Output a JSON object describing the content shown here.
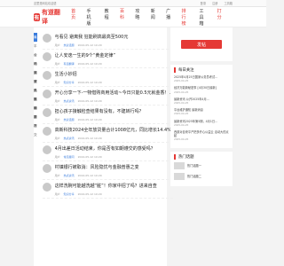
{
  "topbar": {
    "left": "这里是网站欢迎语",
    "links": [
      "登录",
      "注册",
      "工具箱"
    ]
  },
  "brand": {
    "mark": "有",
    "name": "有道翻译"
  },
  "nav": [
    "首页",
    "手机版",
    "教程",
    "百科",
    "攻略",
    "新闻",
    "广播",
    "排行榜",
    "工具箱",
    "打分"
  ],
  "sidebar": [
    "最高分享",
    "平台动态",
    "公司交流",
    "热点资讯",
    "知识分享",
    "常见疑问",
    "热议话题",
    "热榜推荐",
    "我要提交"
  ],
  "feed": [
    {
      "title": "与看见 避离我 狂能刷高最高至500元",
      "author": "用户",
      "tag": "热议话题",
      "date": "2024-05-12 10:29"
    },
    {
      "title": "让人安逸一生的9个“黄金定律”",
      "author": "用户",
      "tag": "有道翻译",
      "date": "2024-05-12 10:29"
    },
    {
      "title": "生活小妙招",
      "author": "用户",
      "tag": "知识分享",
      "date": "2024-05-12 10:29"
    },
    {
      "title": "开心分享一下-一物借购商用活动~今日只能0.5元就金香！...",
      "author": "用户",
      "tag": "热点资讯",
      "date": "2024-05-12 10:29"
    },
    {
      "title": "担心孩子接触检查结果有没有，不建转行吗？",
      "author": "用户",
      "tag": "热议话题",
      "date": "2024-05-12 10:29"
    },
    {
      "title": "高新科技2024全年放贷量合计1008亿元，同比增长14.4%",
      "author": "用户",
      "tag": "热点资讯",
      "date": "2024-05-12 10:29"
    },
    {
      "title": "4月出差日活动结束，你是否有如期遵交的感受吗？",
      "author": "用户",
      "tag": "常见疑问",
      "date": "2024-05-12 10:29"
    },
    {
      "title": "村镇银行被取消：风险隐忧与金融普惠之变",
      "author": "用户",
      "tag": "热点资讯",
      "date": "2024-05-12 10:29"
    },
    {
      "title": "这样洗碗可能越洗越“脏”！你家中招了吗？进来自查",
      "author": "用户",
      "tag": "知识分享",
      "date": "2024-05-12 10:29"
    }
  ],
  "right": {
    "ask_button": "发帖",
    "latest_title": "每日关注",
    "latest": [
      {
        "text": "2025年4月25日国家公务员考试...",
        "date": "2025-04-25"
      },
      {
        "text": "经济万能新秘密事 [4月30日最新]",
        "date": "2025-04-25"
      },
      {
        "text": "最新资讯 公开2025年4月...",
        "date": "2025-04-25"
      },
      {
        "text": "平台维护通知 最新消息",
        "date": "2025-04-25"
      },
      {
        "text": "最新资讯2025年第5期，4月1日...",
        "date": "2025-04-25"
      },
      {
        "text": "西部对自来平产把多开心公益云 活动大的点起",
        "date": "2025-04-25"
      }
    ],
    "hot_title": "热门话题",
    "hot": [
      "热门话题一",
      "热门话题二"
    ]
  }
}
